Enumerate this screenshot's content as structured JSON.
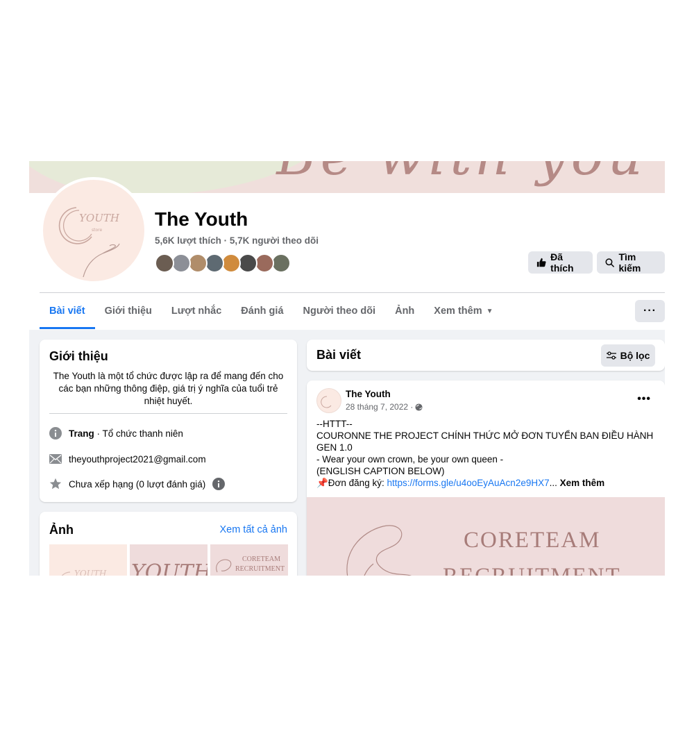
{
  "page": {
    "name": "The Youth",
    "likes": "5,6K lượt thích",
    "separator": " · ",
    "followers": "5,7K người theo dõi",
    "follower_avatar_colors": [
      "#6b5d52",
      "#8c8f97",
      "#b08d6a",
      "#5e6a72",
      "#d08b3d",
      "#4a4a4a",
      "#9a6a5c",
      "#6a7060"
    ]
  },
  "cover": {
    "script_text": "Be with you"
  },
  "avatar": {
    "logo_text": "YOUTH",
    "logo_sub": "store"
  },
  "header_buttons": {
    "liked": "Đã thích",
    "search": "Tìm kiếm"
  },
  "tabs": [
    {
      "label": "Bài viết",
      "active": true
    },
    {
      "label": "Giới thiệu",
      "active": false
    },
    {
      "label": "Lượt nhắc",
      "active": false
    },
    {
      "label": "Đánh giá",
      "active": false
    },
    {
      "label": "Người theo dõi",
      "active": false
    },
    {
      "label": "Ảnh",
      "active": false
    },
    {
      "label": "Xem thêm",
      "active": false
    }
  ],
  "more_menu_label": "···",
  "intro": {
    "title": "Giới thiệu",
    "bio": "The Youth là một tổ chức được lập ra để mang đến cho các bạn những thông điệp, giá trị ý nghĩa của tuổi trẻ nhiệt huyết.",
    "category_label": "Trang",
    "category_value": " · Tổ chức thanh niên",
    "email": "theyouthproject2021@gmail.com",
    "rating": "Chưa xếp hạng (0 lượt đánh giá)"
  },
  "photos": {
    "title": "Ảnh",
    "see_all": "Xem tất cả ảnh",
    "thumb3_text": [
      "CORETEAM",
      "RECRUITMENT"
    ]
  },
  "posts": {
    "title": "Bài viết",
    "filter": "Bộ lọc"
  },
  "post": {
    "author": "The Youth",
    "date": "28 tháng 7, 2022 · ",
    "menu": "•••",
    "lines": [
      "--HTTT--",
      "COURONNE THE PROJECT CHÍNH THỨC MỞ ĐƠN TUYỂN BAN ĐIỀU HÀNH GEN 1.0",
      "- Wear your own crown, be your own queen -",
      "(ENGLISH CAPTION BELOW)"
    ],
    "form_prefix": "📌Đơn đăng ký: ",
    "form_link": "https://forms.gle/u4ooEyAuAcn2e9HX7",
    "ellipsis": "... ",
    "see_more": "Xem thêm",
    "image_title_1": "CORETEAM",
    "image_title_2": "RECRUITMENT"
  },
  "colors": {
    "accent": "#1877f2",
    "button_bg": "#e4e6eb",
    "page_bg": "#f0f2f5",
    "brand_pink": "#f0dfdc"
  }
}
